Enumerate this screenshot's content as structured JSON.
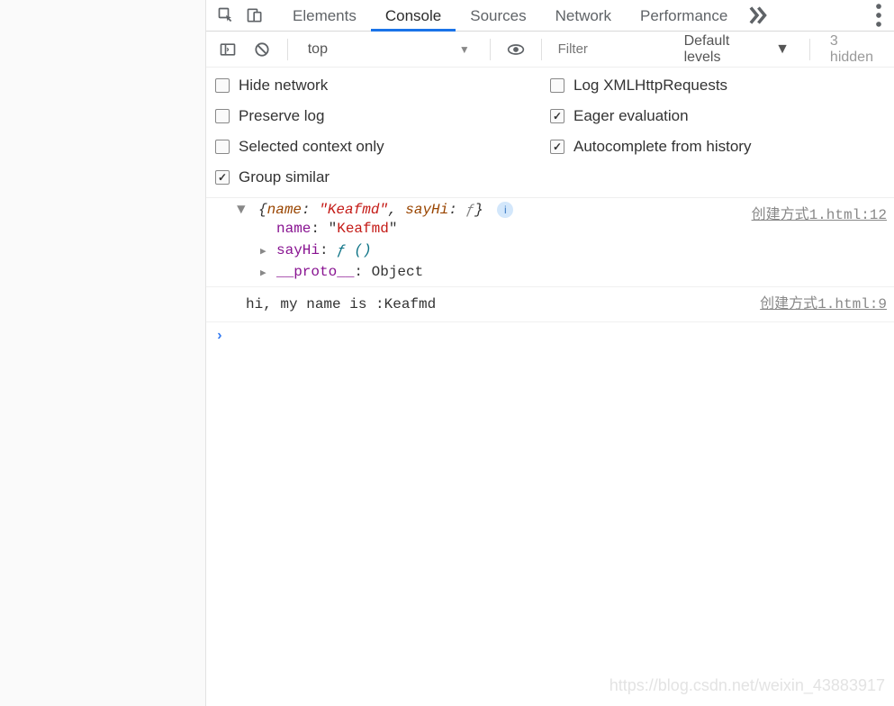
{
  "tabs": {
    "elements": "Elements",
    "console": "Console",
    "sources": "Sources",
    "network": "Network",
    "performance": "Performance"
  },
  "toolbar": {
    "context": "top",
    "filter_placeholder": "Filter",
    "levels": "Default levels",
    "hidden": "3 hidden"
  },
  "settings": {
    "hide_network": "Hide network",
    "log_xhr": "Log XMLHttpRequests",
    "preserve_log": "Preserve log",
    "eager_eval": "Eager evaluation",
    "selected_context": "Selected context only",
    "autocomplete_history": "Autocomplete from history",
    "group_similar": "Group similar"
  },
  "log": {
    "obj": {
      "summary_name_key": "name",
      "summary_name_val": "\"Keafmd\"",
      "summary_sayhi_key": "sayHi",
      "summary_f": "ƒ",
      "info": "i",
      "child_name_key": "name",
      "child_name_val": "Keafmd",
      "child_sayhi_key": "sayHi",
      "child_sayhi_val": "ƒ ()",
      "child_proto_key": "__proto__",
      "child_proto_val": "Object",
      "link": "创建方式1.html:12"
    },
    "msg2": {
      "text": "hi, my name is :Keafmd",
      "link": "创建方式1.html:9"
    }
  },
  "watermark": "https://blog.csdn.net/weixin_43883917"
}
